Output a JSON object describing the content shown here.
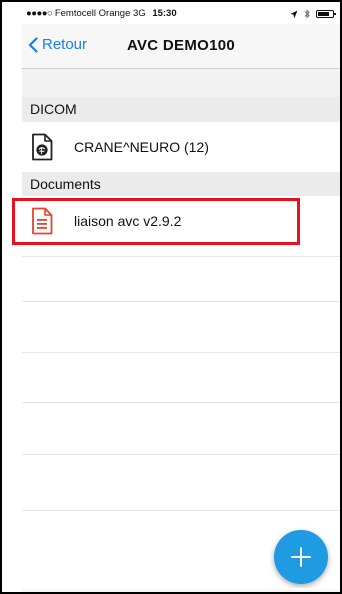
{
  "status_bar": {
    "carrier": "Femtocell Orange",
    "network": "3G",
    "time": "15:30",
    "signal_dots": "●●●●○"
  },
  "nav": {
    "back_label": "Retour",
    "title": "AVC DEMO100"
  },
  "sections": [
    {
      "header": "DICOM",
      "items": [
        {
          "label": "CRANE^NEURO (12)",
          "icon": "brain-scan-document-icon"
        }
      ]
    },
    {
      "header": "Documents",
      "items": [
        {
          "label": "liaison avc v2.9.2",
          "icon": "red-document-icon"
        }
      ]
    }
  ],
  "fab": {
    "icon": "plus-icon"
  },
  "colors": {
    "accent": "#1a7ef0",
    "fab": "#1e9be3",
    "highlight": "#e8121e",
    "document_red": "#e8412c"
  },
  "battery_level": 0.8
}
